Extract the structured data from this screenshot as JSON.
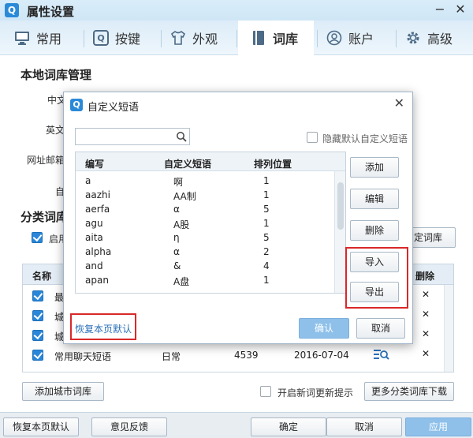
{
  "window": {
    "title": "属性设置",
    "minimize": "−",
    "close": "✕"
  },
  "tabs": [
    {
      "label": "常用",
      "icon": "monitor-icon"
    },
    {
      "label": "按键",
      "icon": "key-icon"
    },
    {
      "label": "外观",
      "icon": "shirt-icon"
    },
    {
      "label": "词库",
      "icon": "book-icon",
      "active": true
    },
    {
      "label": "账户",
      "icon": "user-icon"
    },
    {
      "label": "高级",
      "icon": "gear-icon"
    }
  ],
  "local_dict": {
    "title": "本地词库管理",
    "rows": [
      "中文",
      "英文",
      "网址邮箱",
      "自"
    ]
  },
  "category_dict": {
    "title": "分类词库",
    "enable_label": "启用",
    "custom_button": "定词库",
    "headers": {
      "name": "名称",
      "delete": "删除"
    },
    "rows": [
      {
        "name": "最",
        "category": "",
        "count": "",
        "date": ""
      },
      {
        "name": "城",
        "category": "",
        "count": "",
        "date": ""
      },
      {
        "name": "城",
        "category": "",
        "count": "",
        "date": ""
      },
      {
        "name": "常用聊天短语",
        "category": "日常",
        "count": "4539",
        "date": "2016-07-04"
      }
    ],
    "add_city_button": "添加城市词库",
    "new_dict_tip": "开启新词更新提示",
    "more_download_button": "更多分类词库下载"
  },
  "footer": {
    "restore": "恢复本页默认",
    "feedback": "意见反馈",
    "ok": "确定",
    "cancel": "取消",
    "apply": "应用"
  },
  "dialog": {
    "title": "自定义短语",
    "close": "✕",
    "search_placeholder": "",
    "hide_default_label": "隐藏默认自定义短语",
    "headers": {
      "abbr": "编写",
      "phrase": "自定义短语",
      "position": "排列位置"
    },
    "rows": [
      {
        "abbr": "a",
        "phrase": "啊",
        "position": "1"
      },
      {
        "abbr": "aazhi",
        "phrase": "AA制",
        "position": "1"
      },
      {
        "abbr": "aerfa",
        "phrase": "α",
        "position": "5"
      },
      {
        "abbr": "agu",
        "phrase": "A股",
        "position": "1"
      },
      {
        "abbr": "aita",
        "phrase": "η",
        "position": "5"
      },
      {
        "abbr": "alpha",
        "phrase": "α",
        "position": "2"
      },
      {
        "abbr": "and",
        "phrase": "&",
        "position": "4"
      },
      {
        "abbr": "apan",
        "phrase": "A盘",
        "position": "1"
      }
    ],
    "buttons": {
      "add": "添加",
      "edit": "编辑",
      "delete": "删除",
      "import": "导入",
      "export": "导出"
    },
    "restore_link": "恢复本页默认",
    "confirm": "确认",
    "cancel": "取消"
  },
  "colors": {
    "accent": "#2a86d8",
    "highlight_box": "#d9282a",
    "delete_x": "#e03b3b"
  }
}
